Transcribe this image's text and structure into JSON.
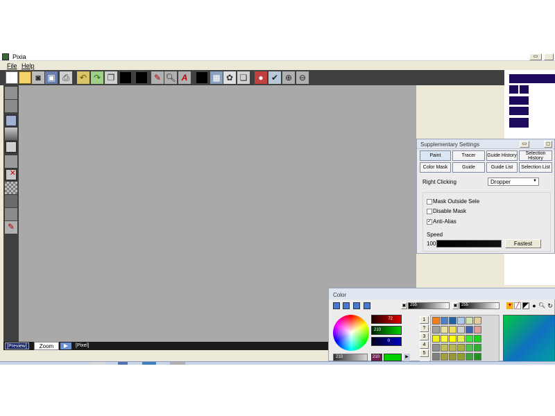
{
  "app": {
    "title": "Pixia"
  },
  "menu": [
    "File",
    "Help"
  ],
  "status_bar": {
    "preview_label": "[Preview]",
    "zoom_label": "Zoom",
    "pixel_label": "[Pixel]"
  },
  "supplementary": {
    "title": "Supplementary Settings",
    "tabs_row1": [
      "Paint",
      "Tracer",
      "Guide History",
      "Selection History"
    ],
    "tabs_row2": [
      "Color Mask",
      "Guide",
      "Guide List",
      "Selection List"
    ],
    "right_clicking_label": "Right Clicking",
    "right_clicking_value": "Dropper",
    "options": [
      {
        "label": "Mask Outside Sele",
        "checked": false
      },
      {
        "label": "Disable Mask",
        "checked": false
      },
      {
        "label": "Anti-Alias",
        "checked": true
      }
    ],
    "speed_label": "Speed",
    "speed_value": "100",
    "speed_setting": "Fastest"
  },
  "color_panel": {
    "title": "Color",
    "rgb_values": [
      "72",
      "210",
      "0"
    ],
    "hue_value": "210",
    "value_readout": "210",
    "slot_numbers": [
      "1",
      "?",
      "3",
      "4",
      "5"
    ],
    "opacity_a": "255",
    "opacity_b": "255"
  },
  "colors": {
    "workspace": "#a9a9a9",
    "toolbar": "#404040",
    "palette_navy": "#1e0a5c",
    "chrome": "#ece9d8"
  }
}
